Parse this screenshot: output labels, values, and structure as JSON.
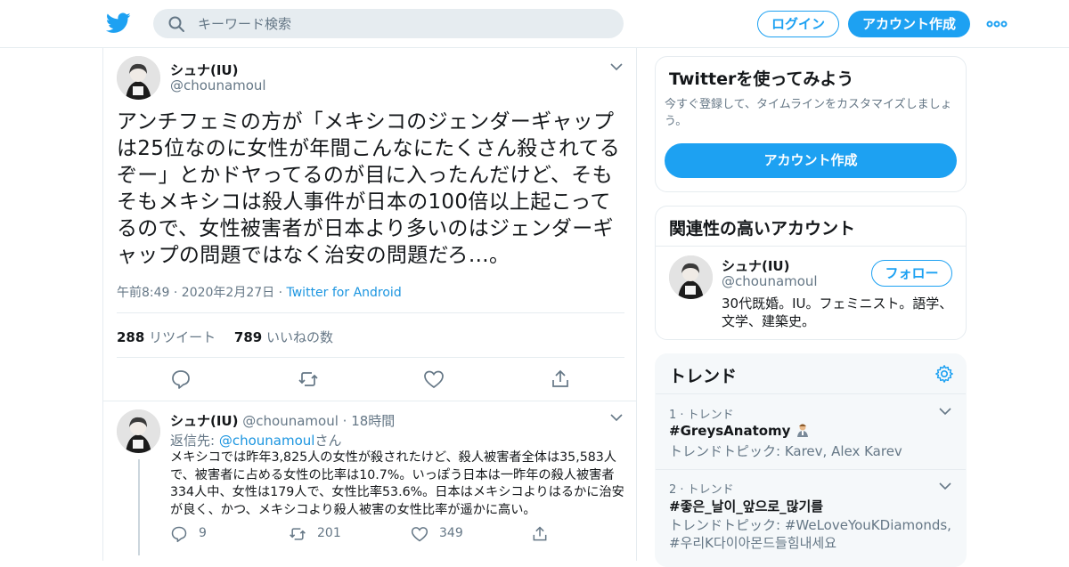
{
  "header": {
    "search_placeholder": "キーワード検索",
    "login_label": "ログイン",
    "signup_label": "アカウント作成",
    "brand_color": "#1da1f2"
  },
  "main_tweet": {
    "name": "シュナ(IU)",
    "handle": "@chounamoul",
    "text": "アンチフェミの方が「メキシコのジェンダーギャップは25位なのに女性が年間こんなにたくさん殺されてるぞー」とかドヤってるのが目に入ったんだけど、そもそもメキシコは殺人事件が日本の100倍以上起こってるので、女性被害者が日本より多いのはジェンダーギャップの問題ではなく治安の問題だろ…。",
    "timestamp": "午前8:49 · 2020年2月27日",
    "dot": "·",
    "source": "Twitter for Android",
    "retweet_count": "288",
    "retweet_label": "リツイート",
    "like_count": "789",
    "like_label": "いいねの数"
  },
  "reply_tweet": {
    "name": "シュナ(IU)",
    "handle": "@chounamoul",
    "time": "· 18時間",
    "reply_prefix": "返信先: ",
    "reply_handle": "@chounamoul",
    "reply_suffix": "さん",
    "text": "メキシコでは昨年3,825人の女性が殺されたけど、殺人被害者全体は35,583人で、被害者に占める女性の比率は10.7%。いっぽう日本は一昨年の殺人被害者334人中、女性は179人で、女性比率53.6%。日本はメキシコよりはるかに治安が良く、かつ、メキシコより殺人被害の女性比率が遥かに高い。",
    "reply_count": "9",
    "retweet_count": "201",
    "like_count": "349"
  },
  "signup_card": {
    "title": "Twitterを使ってみよう",
    "description": "今すぐ登録して、タイムラインをカスタマイズしましょう。",
    "cta_label": "アカウント作成"
  },
  "related_card": {
    "title": "関連性の高いアカウント",
    "name": "シュナ(IU)",
    "handle": "@chounamoul",
    "follow_label": "フォロー",
    "bio": "30代既婚。IU。フェミニスト。語学、文学、建築史。"
  },
  "trends_card": {
    "title": "トレンド",
    "items": [
      {
        "context": "1 · トレンド",
        "name": "#GreysAnatomy",
        "topic": "トレンドトピック: Karev, Alex Karev"
      },
      {
        "context": "2 · トレンド",
        "name": "#좋은_날이_앞으로_많기를",
        "topic": "トレンドトピック: #WeLoveYouKDiamonds, #우리K다이아몬드들힘내세요"
      }
    ]
  }
}
